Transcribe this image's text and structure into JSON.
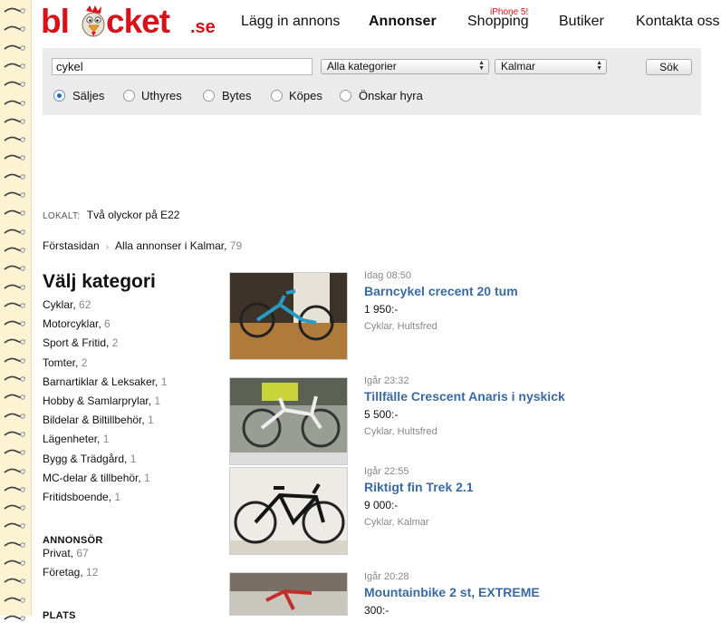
{
  "logo": {
    "text_main": "blocket",
    "text_suffix": ".se"
  },
  "nav": {
    "lagg_in": "Lägg in annons",
    "annonser": "Annonser",
    "shopping": "Shopping",
    "shopping_badge": "iPhone 5!",
    "butiker": "Butiker",
    "kontakta": "Kontakta oss"
  },
  "search": {
    "query": "cykel",
    "category": "Alla kategorier",
    "region": "Kalmar",
    "button": "Sök",
    "types": [
      {
        "label": "Säljes",
        "checked": true
      },
      {
        "label": "Uthyres",
        "checked": false
      },
      {
        "label": "Bytes",
        "checked": false
      },
      {
        "label": "Köpes",
        "checked": false
      },
      {
        "label": "Önskar hyra",
        "checked": false
      }
    ]
  },
  "lokalt": {
    "tag": "LOKALT:",
    "text": "Två olyckor på E22"
  },
  "breadcrumb": {
    "home": "Förstasidan",
    "current": "Alla annonser i Kalmar,",
    "count": "79"
  },
  "categories": {
    "title": "Välj kategori",
    "items": [
      {
        "label": "Cyklar,",
        "count": "62"
      },
      {
        "label": "Motorcyklar,",
        "count": "6"
      },
      {
        "label": "Sport & Fritid,",
        "count": "2"
      },
      {
        "label": "Tomter,",
        "count": "2"
      },
      {
        "label": "Barnartiklar & Leksaker,",
        "count": "1"
      },
      {
        "label": "Hobby & Samlarprylar,",
        "count": "1"
      },
      {
        "label": "Bildelar & Biltillbehör,",
        "count": "1"
      },
      {
        "label": "Lägenheter,",
        "count": "1"
      },
      {
        "label": "Bygg & Trädgård,",
        "count": "1"
      },
      {
        "label": "MC-delar & tillbehör,",
        "count": "1"
      },
      {
        "label": "Fritidsboende,",
        "count": "1"
      }
    ],
    "annonsor_head": "ANNONSÖR",
    "annonsor": [
      {
        "label": "Privat,",
        "count": "67"
      },
      {
        "label": "Företag,",
        "count": "12"
      }
    ],
    "plats_head": "PLATS"
  },
  "ads": [
    {
      "time": "Idag 08:50",
      "title": "Barncykel crecent 20 tum",
      "price": "1 950:-",
      "location": "Cyklar, Hultsfred"
    },
    {
      "time": "Igår 23:32",
      "title": "Tillfälle Crescent Anaris i nyskick",
      "price": "5 500:-",
      "location": "Cyklar, Hultsfred"
    },
    {
      "time": "Igår 22:55",
      "title": "Riktigt fin Trek 2.1",
      "price": "9 000:-",
      "location": "Cyklar, Kalmar"
    },
    {
      "time": "Igår 20:28",
      "title": "Mountainbike 2 st, EXTREME",
      "price": "300:-",
      "location": ""
    }
  ],
  "colors": {
    "logo_red": "#d8121a",
    "link_blue": "#3a6aa3",
    "muted": "#888888",
    "search_bg": "#ebebeb"
  }
}
